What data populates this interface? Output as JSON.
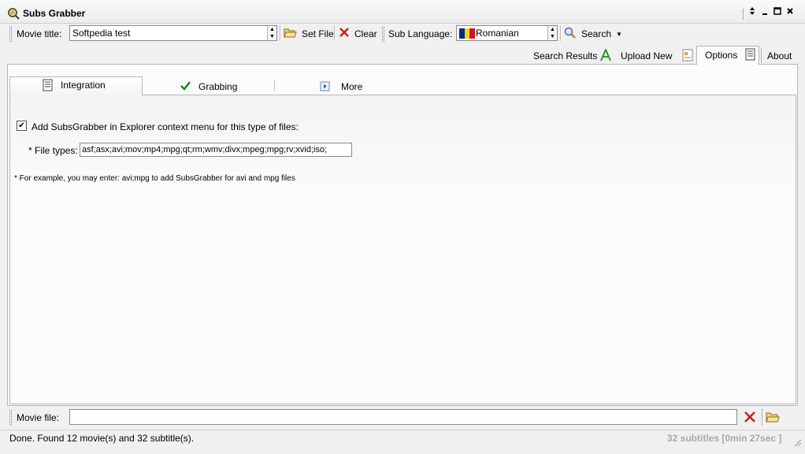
{
  "app": {
    "title": "Subs Grabber"
  },
  "toolbar": {
    "movie_title_label": "Movie title:",
    "movie_title_value": "Softpedia test",
    "set_file_label": "Set File",
    "clear_label": "Clear",
    "sub_language_label": "Sub Language:",
    "sub_language_value": "Romanian",
    "search_label": "Search"
  },
  "tabs": {
    "search_results": "Search Results",
    "upload_new": "Upload New",
    "options": "Options",
    "about": "About"
  },
  "subtabs": {
    "integration": "Integration",
    "grabbing": "Grabbing",
    "more": "More"
  },
  "integration": {
    "checkbox_label": "Add SubsGrabber in Explorer context menu for this type of files:",
    "checkbox_checked": true,
    "file_types_label": "* File types:",
    "file_types_value": "asf;asx;avi;mov;mp4;mpg;qt;rm;wmv;divx;mpeg;mpg;rv;xvid;iso;",
    "example_note": "* For example, you may enter: avi;mpg to add SubsGrabber for avi and mpg files"
  },
  "movie_file": {
    "label": "Movie file:",
    "value": ""
  },
  "status": {
    "text": "Done. Found 12 movie(s) and 32 subtitle(s).",
    "right_text": "32 subtitles  [0min 27sec ]"
  },
  "colors": {
    "flag_blue": "#002b7f",
    "flag_yellow": "#fcd116",
    "flag_red": "#ce1126",
    "clear_red": "#c8201f",
    "check_green": "#1d8a1d",
    "status_right": "#a8a8a8"
  }
}
